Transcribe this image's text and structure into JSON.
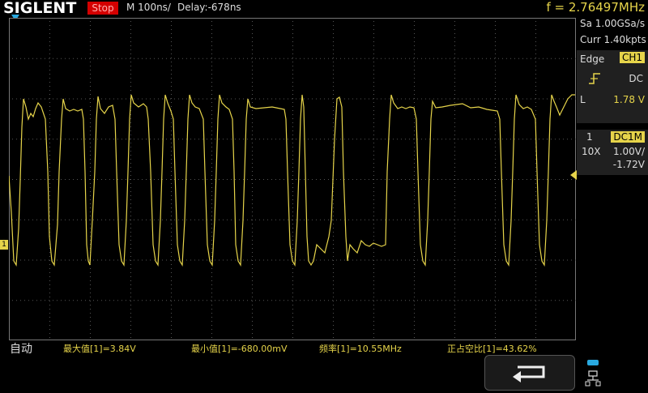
{
  "header": {
    "brand": "SIGLENT",
    "run_state": "Stop",
    "timebase": "M 100ns/",
    "delay": "Delay:-678ns",
    "frequency": "f = 2.76497MHz"
  },
  "acquisition": {
    "sample_rate": "Sa 1.00GSa/s",
    "memory_depth": "Curr 1.40kpts"
  },
  "trigger": {
    "type_label": "Edge",
    "source": "CH1",
    "coupling": "DC",
    "level_label": "L",
    "level": "1.78 V"
  },
  "channel": {
    "number": "1",
    "coupling": "DC1M",
    "probe": "10X",
    "scale": "1.00V/",
    "offset": "-1.72V"
  },
  "measurements": {
    "mode": "自动",
    "items": [
      {
        "label": "最大值[1]=3.84V"
      },
      {
        "label": "最小值[1]=-680.00mV"
      },
      {
        "label": "频率[1]=10.55MHz"
      },
      {
        "label": "正占空比[1]=43.62%"
      }
    ]
  },
  "colors": {
    "trace": "#e6d44a",
    "stop_bg": "#d40000",
    "trigger_marker": "#29a9e0",
    "panel_bg": "#202020"
  },
  "icons": {
    "back": "back-arrow-icon",
    "network": "network-icon",
    "trigger_slope": "rising-edge-icon"
  }
}
